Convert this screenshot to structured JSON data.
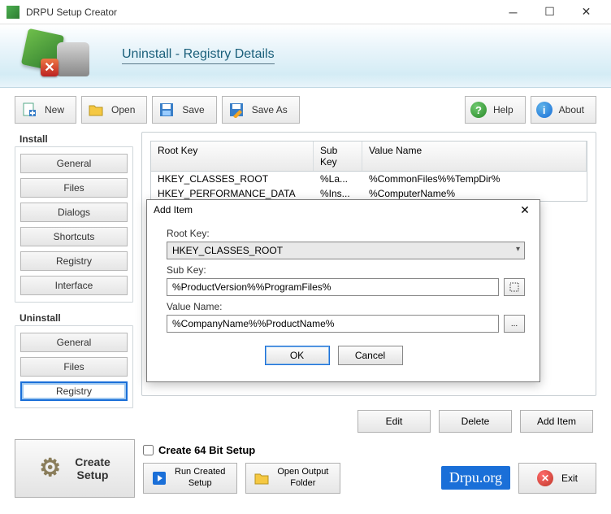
{
  "window": {
    "title": "DRPU Setup Creator"
  },
  "banner": {
    "title": "Uninstall - Registry Details"
  },
  "toolbar": {
    "new": "New",
    "open": "Open",
    "save": "Save",
    "saveAs": "Save As",
    "help": "Help",
    "about": "About"
  },
  "sidebar": {
    "install": {
      "title": "Install",
      "items": [
        "General",
        "Files",
        "Dialogs",
        "Shortcuts",
        "Registry",
        "Interface"
      ]
    },
    "uninstall": {
      "title": "Uninstall",
      "items": [
        "General",
        "Files",
        "Registry"
      ]
    }
  },
  "grid": {
    "headers": {
      "root": "Root Key",
      "sub": "Sub Key",
      "value": "Value Name"
    },
    "rows": [
      {
        "root": "HKEY_CLASSES_ROOT",
        "sub": "%La...",
        "value": "%CommonFiles%%TempDir%"
      },
      {
        "root": "HKEY_PERFORMANCE_DATA",
        "sub": "%Ins...",
        "value": "%ComputerName%"
      }
    ]
  },
  "modal": {
    "title": "Add Item",
    "rootKeyLabel": "Root Key:",
    "rootKeyValue": "HKEY_CLASSES_ROOT",
    "subKeyLabel": "Sub Key:",
    "subKeyValue": "%ProductVersion%%ProgramFiles%",
    "valueNameLabel": "Value Name:",
    "valueNameValue": "%CompanyName%%ProductName%",
    "ok": "OK",
    "cancel": "Cancel"
  },
  "actions": {
    "edit": "Edit",
    "delete": "Delete",
    "addItem": "Add Item"
  },
  "footer": {
    "createSetup": "Create\nSetup",
    "create64": "Create 64 Bit Setup",
    "runCreated": "Run Created\nSetup",
    "openOutput": "Open Output\nFolder",
    "brand": "Drpu.org",
    "exit": "Exit"
  }
}
